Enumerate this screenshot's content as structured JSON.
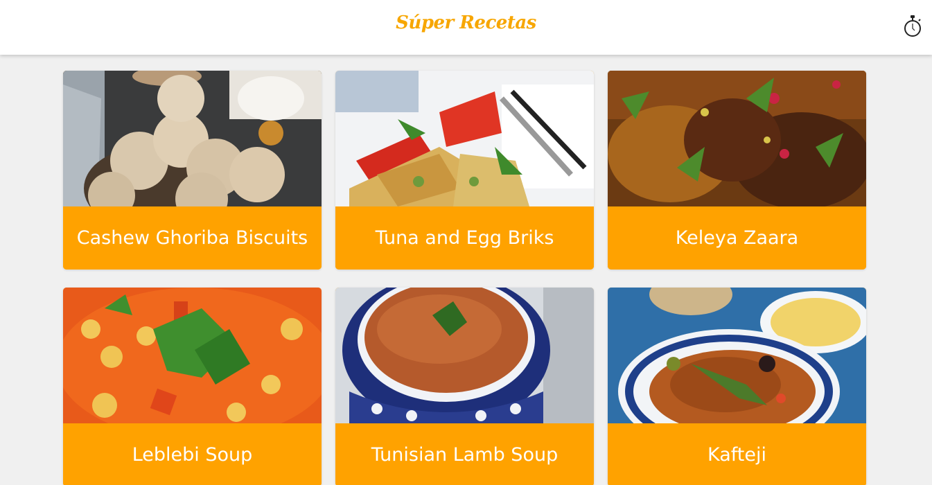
{
  "header": {
    "logo": "Súper Recetas",
    "timer_icon": "stopwatch-icon"
  },
  "colors": {
    "accent": "#ffa200",
    "logo": "#f7a600",
    "background": "#f0f0f0"
  },
  "recipes": [
    {
      "title": "Cashew Ghoriba Biscuits",
      "photo": "ghoriba-biscuits-photo"
    },
    {
      "title": "Tuna and Egg Briks",
      "photo": "egg-briks-photo"
    },
    {
      "title": "Keleya Zaara",
      "photo": "keleya-zaara-photo"
    },
    {
      "title": "Leblebi Soup",
      "photo": "leblebi-soup-photo"
    },
    {
      "title": "Tunisian Lamb Soup",
      "photo": "lamb-soup-photo"
    },
    {
      "title": "Kafteji",
      "photo": "kafteji-photo"
    }
  ]
}
